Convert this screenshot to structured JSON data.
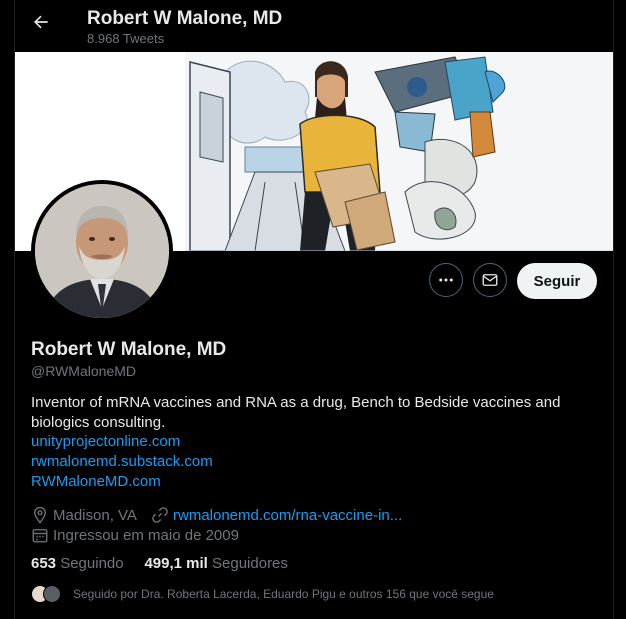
{
  "header": {
    "title": "Robert W Malone, MD",
    "tweet_count": "8.968 Tweets"
  },
  "actions": {
    "more_icon": "more-dots-icon",
    "message_icon": "envelope-icon",
    "follow_label": "Seguir"
  },
  "profile": {
    "name": "Robert W Malone, MD",
    "handle": "@RWMaloneMD",
    "bio": "Inventor of mRNA vaccines and RNA as a drug, Bench to Bedside vaccines and biologics consulting.",
    "links": [
      "unityprojectonline.com",
      "rwmalonemd.substack.com",
      "RWMaloneMD.com"
    ],
    "location": "Madison, VA",
    "website": "rwmalonemd.com/rna-vaccine-in...",
    "joined": "Ingressou em maio de 2009"
  },
  "stats": {
    "following_count": "653",
    "following_label": "Seguindo",
    "followers_count": "499,1 mil",
    "followers_label": "Seguidores"
  },
  "followed_by": "Seguido por Dra. Roberta Lacerda, Eduardo Pigu e outros 156 que você segue",
  "colors": {
    "accent": "#1d9bf0",
    "background": "#000000",
    "muted": "#71767b",
    "text": "#e7e9ea"
  }
}
